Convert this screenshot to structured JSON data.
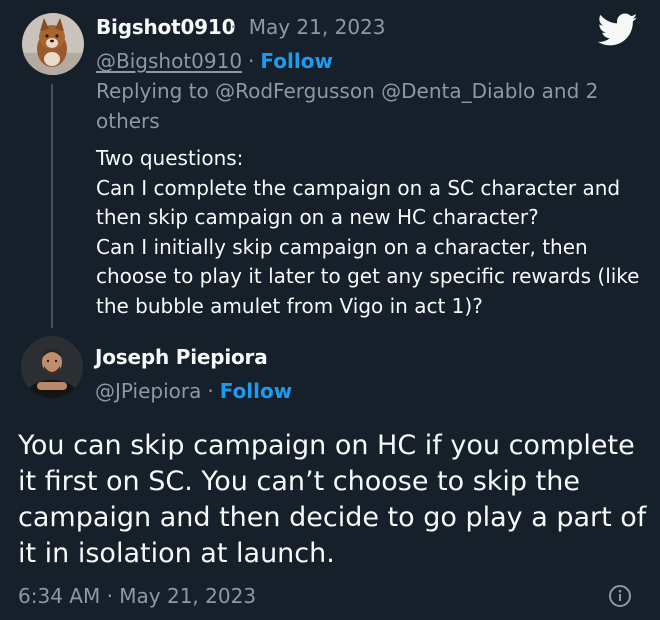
{
  "brand": {
    "icon": "twitter-bird-icon",
    "color": "#1d9bf0"
  },
  "reply_tweet": {
    "display_name": "Bigshot0910",
    "date": "May 21, 2023",
    "handle": "@Bigshot0910",
    "follow_label": "Follow",
    "replying_lines": [
      "Replying to @RodFergusson @Denta_Diablo and 2",
      "others"
    ],
    "body_lines": [
      "Two questions:",
      "Can I complete the campaign on a SC character and",
      "then skip campaign on a new HC character?",
      "Can I initially skip campaign on a character, then",
      "choose to play it later to get any specific rewards (like",
      "the bubble amulet from Vigo in act 1)?"
    ]
  },
  "main_tweet": {
    "display_name": "Joseph Piepiora",
    "handle": "@JPiepiora",
    "follow_label": "Follow",
    "body_lines": [
      "You can skip campaign on HC if you complete",
      "it first on SC. You can’t choose to skip the",
      "campaign and then decide to go play a part of",
      "it in isolation at launch."
    ],
    "timestamp": "6:34 AM · May 21, 2023",
    "info_icon": "info-icon"
  },
  "colors": {
    "background": "#15202b",
    "text": "#f7f9f9",
    "muted": "#8b98a5",
    "accent": "#1d9bf0"
  }
}
